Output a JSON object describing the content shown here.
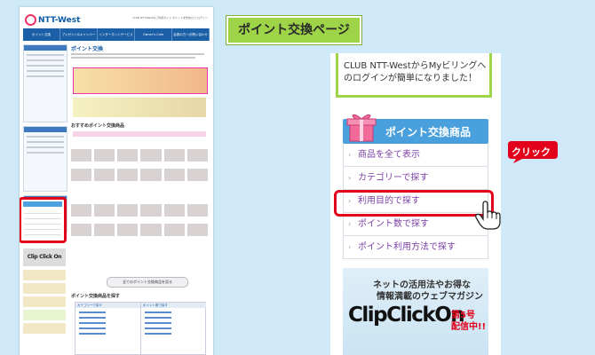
{
  "page_title": "ポイント交換ページ",
  "mini_page": {
    "logo": "NTT-West",
    "toplinks": "CLUB NTT-Westのご利用ガイド ポイントを貯めたい ログイン",
    "nav": [
      "ポイント交換",
      "プレゼント&キャンペーン",
      "インターネットサービス",
      "Owner's Cafe",
      "会員の方へお問い合わせ"
    ],
    "title": "ポイント交換",
    "section_recommend": "おすすめポイント交換商品",
    "show_all": "全てのポイント交換商品を見る",
    "section_search": "ポイント交換商品を探す",
    "search_col1": "カテゴリーで探す",
    "search_col2": "ポイント数で探す",
    "clip_mini": "Clip Click On",
    "mybilling_mini": "Myビリング"
  },
  "notice_text": "CLUB NTT-WestからMyビリングへのログインが簡単になりました！",
  "menu": {
    "header": "ポイント交換商品",
    "items": [
      {
        "label": "商品を全て表示"
      },
      {
        "label": "カテゴリーで探す"
      },
      {
        "label": "利用目的で探す"
      },
      {
        "label": "ポイント数で探す"
      },
      {
        "label": "ポイント利用方法で探す"
      }
    ]
  },
  "click_label": "クリック",
  "banner": {
    "line1": "ネットの活用法やお得な",
    "line2": "情報満載のウェブマガジン",
    "logo": "ClipClickOn",
    "issue1": "第5号",
    "issue2": "配信中!!"
  },
  "colors": {
    "highlight": "#e2001a",
    "title_label": "#9ed447",
    "menu_header": "#4aa0dc",
    "menu_text": "#7a3fa4"
  }
}
